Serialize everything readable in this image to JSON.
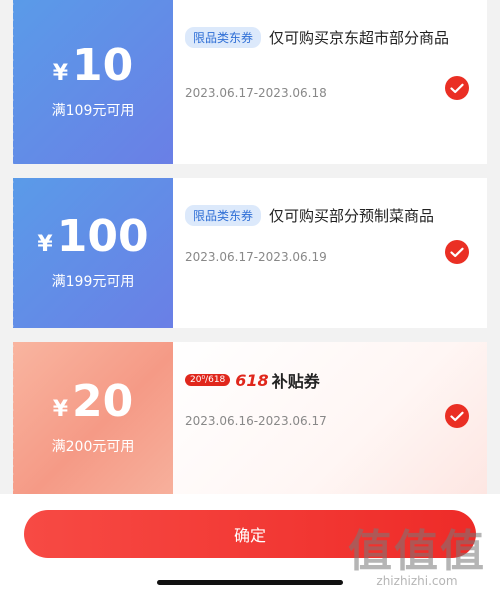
{
  "coupons": [
    {
      "yen": "¥",
      "amount": "10",
      "condition": "满109元可用",
      "tag": "限品类东券",
      "title": "仅可购买京东超市部分商品",
      "date": "2023.06.17-2023.06.18",
      "selected": true
    },
    {
      "yen": "¥",
      "amount": "100",
      "condition": "满199元可用",
      "tag": "限品类东券",
      "title": "仅可购买部分预制菜商品",
      "date": "2023.06.17-2023.06.19",
      "selected": true
    },
    {
      "yen": "¥",
      "amount": "20",
      "condition": "满200元可用",
      "badge_pill": "20⁰/618",
      "badge_brand": "618",
      "badge_title": "补贴券",
      "date": "2023.06.16-2023.06.17",
      "selected": true
    }
  ],
  "confirm_label": "确定",
  "watermark": {
    "big": "值值值",
    "small": "zhizhizhi.com"
  },
  "colors": {
    "accent": "#ea2f24",
    "coupon_blue": "#6a7fe6",
    "coupon_pink": "#f59a86"
  }
}
